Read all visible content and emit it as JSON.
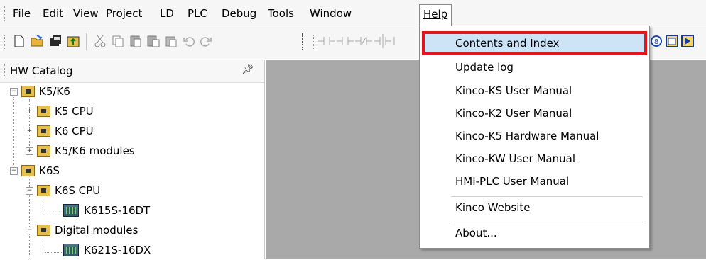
{
  "menubar": {
    "items": [
      {
        "label": "File"
      },
      {
        "label": "Edit"
      },
      {
        "label": "View"
      },
      {
        "label": "Project"
      },
      {
        "label": "LD"
      },
      {
        "label": "PLC"
      },
      {
        "label": "Debug"
      },
      {
        "label": "Tools"
      },
      {
        "label": "Window"
      },
      {
        "label": "Help"
      }
    ]
  },
  "help_menu": {
    "items": [
      {
        "label": "Contents and Index"
      },
      {
        "label": "Update log"
      },
      {
        "label": "Kinco-KS User Manual"
      },
      {
        "label": "Kinco-K2 User Manual"
      },
      {
        "label": "Kinco-K5 Hardware Manual"
      },
      {
        "label": "Kinco-KW User Manual"
      },
      {
        "label": "HMI-PLC User Manual"
      },
      {
        "label": "Kinco Website"
      },
      {
        "label": "About..."
      }
    ]
  },
  "catalog": {
    "title": "HW Catalog",
    "pin_icon": "pin-icon",
    "tree": [
      {
        "label": "K5/K6"
      },
      {
        "label": "K5 CPU"
      },
      {
        "label": "K6 CPU"
      },
      {
        "label": "K5/K6 modules"
      },
      {
        "label": "K6S"
      },
      {
        "label": "K6S CPU"
      },
      {
        "label": "K615S-16DT"
      },
      {
        "label": "Digital modules"
      },
      {
        "label": "K621S-16DX"
      }
    ]
  },
  "colors": {
    "highlight_outline": "#e4151c",
    "highlight_fill": "#cde4f7",
    "workspace": "#a9a9a9"
  }
}
